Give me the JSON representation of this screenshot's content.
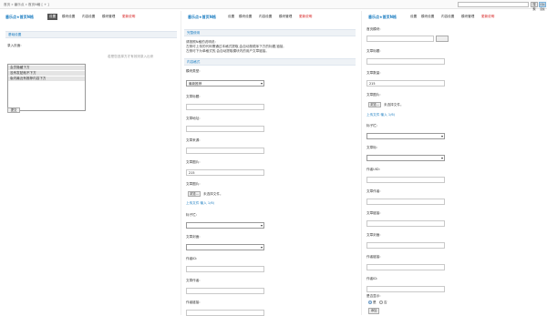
{
  "topbar": {
    "breadcrumb": "首页 » 番乐点 » 首页N格 [ + ]",
    "search_button": "搜索",
    "action_button": "控制面板"
  },
  "brand": "番乐点★首页N格",
  "tabs": [
    "设置",
    "模块设置",
    "内容设置",
    "模块管理",
    "更新说明"
  ],
  "left": {
    "section": "基础设置",
    "field_label": "录入页面:",
    "options": [
      "会员隐藏下方",
      "没有发贴就不下方",
      "版内最近有推荐内容下方"
    ],
    "note": "若是您选择方才有效则录入出来",
    "submit": "提交"
  },
  "middle": {
    "section": "完整使用",
    "info": [
      "请按照N格的说明说:",
      "左侧可上传的代码需通过本格式提取,会自动按顺序下方的标题,链接,",
      "左侧可下为单格式的,会自动提取模块内的用户文章链接。"
    ],
    "section2": "内容格式",
    "type_label": "模块类型:",
    "type_value": "最新推荐",
    "fields": [
      "文章标题:",
      "文章地址:",
      "文章来源:",
      "文章图片:"
    ],
    "count_value": "215",
    "file_label": "文章图片:",
    "browse": "浏览...",
    "nofile": "未选择文件。",
    "upload": "上传文件 输入 1/6)",
    "fields2": [
      "标子栏:",
      "文章封面:",
      "作者ID:",
      "文章作者:",
      "作者链接:"
    ]
  },
  "right": {
    "fields": [
      "首页模块:",
      "文章标题:",
      "文章数量:",
      "文章图片:"
    ],
    "count_value": "215",
    "browse": "浏览...",
    "nofile": "未选择文件。",
    "upload": "上传文件 输入 1/6)",
    "fields2": [
      "标子栏:",
      "文章标:",
      "作者UID:",
      "文章作者:",
      "文章链接:",
      "文章封面:",
      "作者链接:",
      "作者ID:"
    ],
    "radio_label": "是否显示:",
    "radio_options": [
      "是",
      "否"
    ],
    "submit": "添加"
  }
}
